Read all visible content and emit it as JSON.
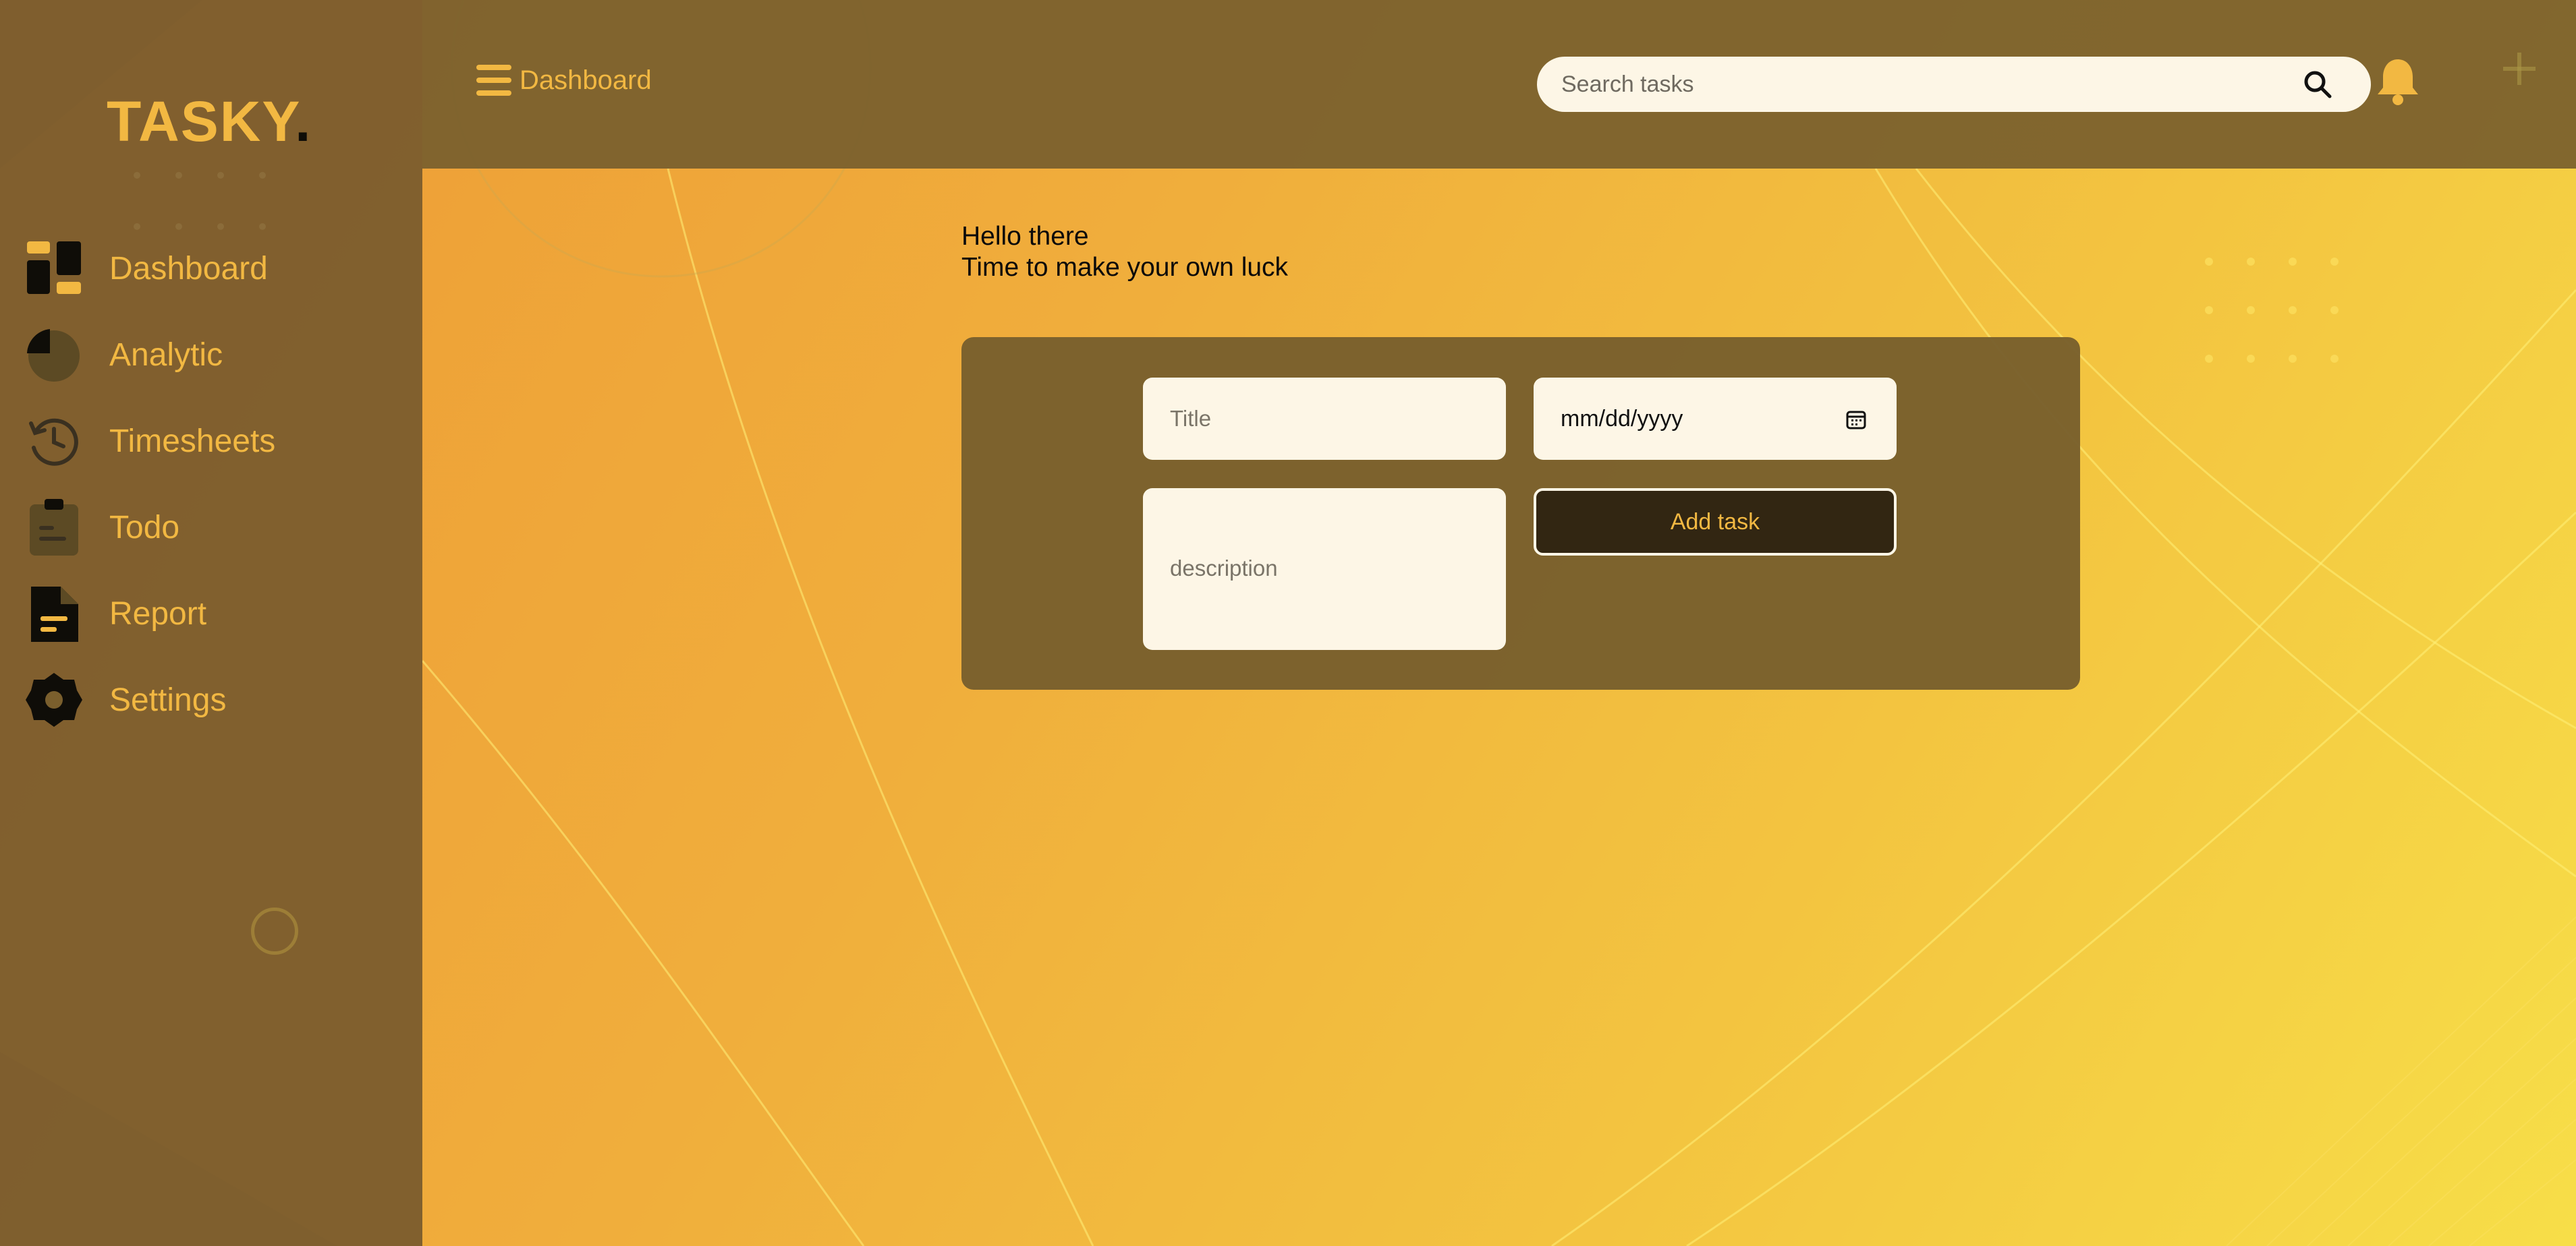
{
  "app": {
    "logo_main": "TASKY",
    "logo_dot": "."
  },
  "sidebar": {
    "items": [
      {
        "label": "Dashboard",
        "icon": "dashboard-icon"
      },
      {
        "label": "Analytic",
        "icon": "pie-chart-icon"
      },
      {
        "label": "Timesheets",
        "icon": "history-clock-icon"
      },
      {
        "label": "Todo",
        "icon": "clipboard-icon"
      },
      {
        "label": "Report",
        "icon": "document-icon"
      },
      {
        "label": "Settings",
        "icon": "gear-icon"
      }
    ]
  },
  "header": {
    "breadcrumb": "Dashboard",
    "menu_icon": "hamburger-menu-icon",
    "search_placeholder": "Search tasks",
    "search_icon": "search-icon",
    "notification_icon": "bell-icon"
  },
  "main": {
    "greeting_line1": "Hello there",
    "greeting_line2": "Time to make your own luck"
  },
  "task_form": {
    "title_placeholder": "Title",
    "date_placeholder": "mm/dd/yyyy",
    "description_placeholder": "description",
    "submit_label": "Add task",
    "calendar_icon": "calendar-icon"
  },
  "colors": {
    "accent": "#f2b842",
    "panel": "#7a5f2d",
    "input_bg": "#fdf6e6",
    "button_bg": "#322612"
  }
}
